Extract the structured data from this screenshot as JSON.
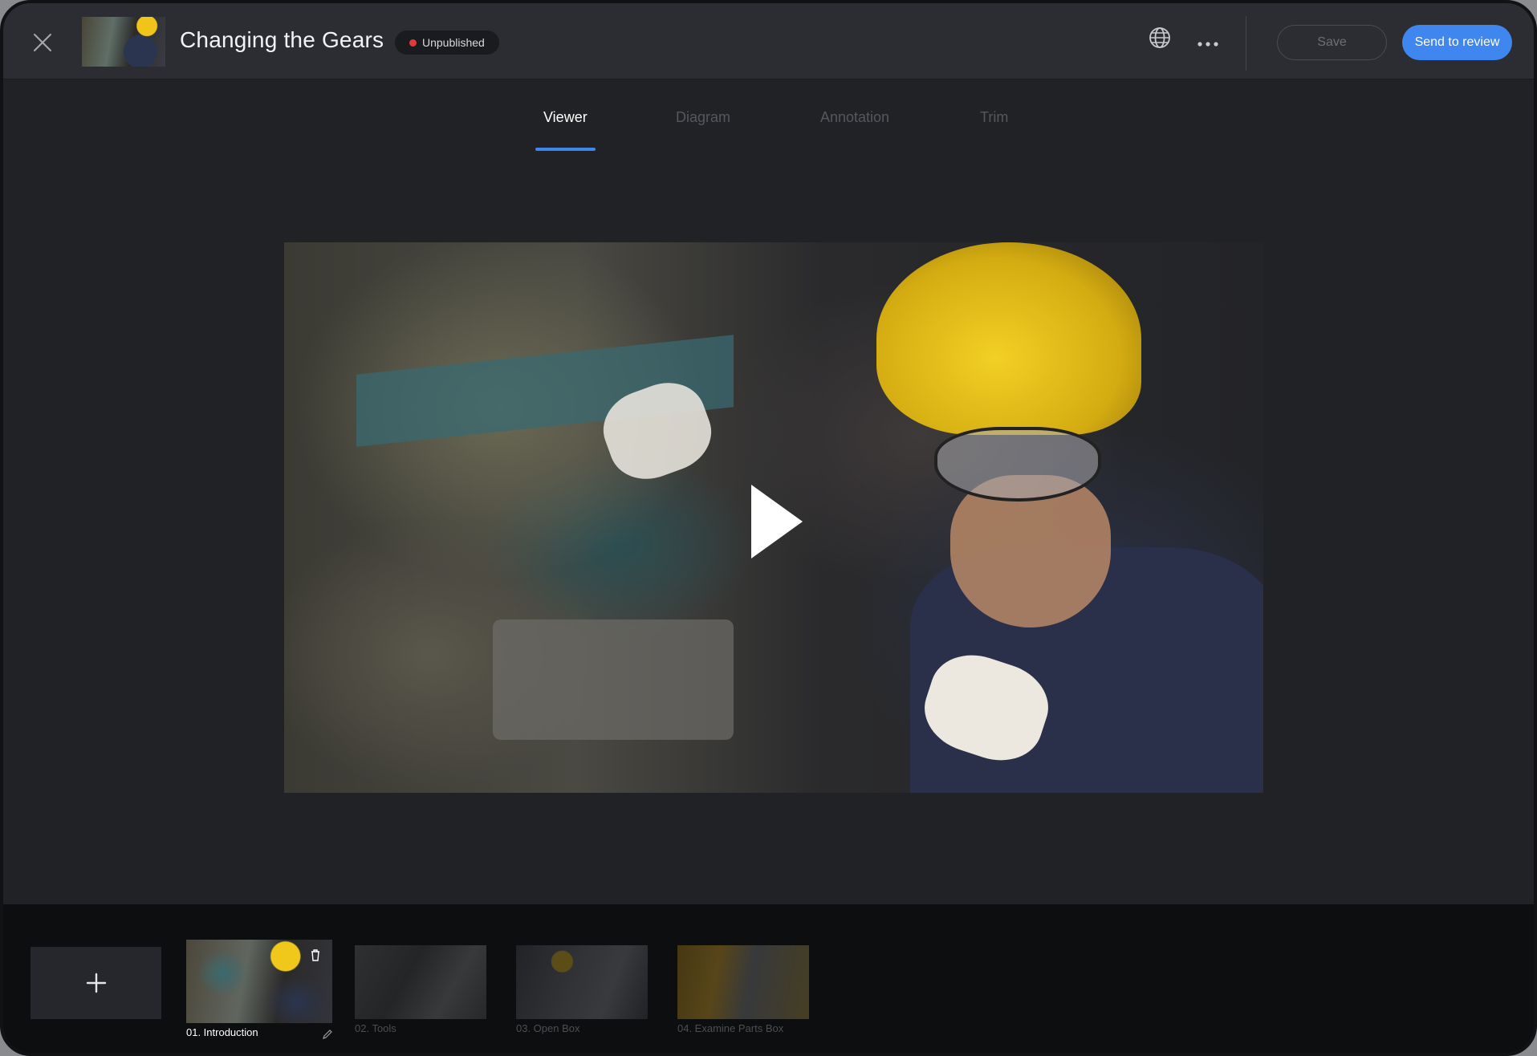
{
  "header": {
    "title": "Changing the Gears",
    "status": "Unpublished",
    "save_label": "Save",
    "review_label": "Send to review"
  },
  "tabs": [
    {
      "label": "Viewer",
      "active": true
    },
    {
      "label": "Diagram",
      "active": false
    },
    {
      "label": "Annotation",
      "active": false
    },
    {
      "label": "Trim",
      "active": false
    }
  ],
  "clips": [
    {
      "label": "01. Introduction",
      "selected": true
    },
    {
      "label": "02. Tools",
      "selected": false
    },
    {
      "label": "03. Open Box",
      "selected": false
    },
    {
      "label": "04. Examine Parts Box",
      "selected": false
    }
  ],
  "icons": {
    "close": "close-icon",
    "globe": "globe-icon",
    "more": "more-horizontal-icon",
    "play": "play-icon",
    "add": "plus-icon",
    "trash": "trash-icon",
    "pencil": "pencil-icon"
  },
  "colors": {
    "accent": "#3f86ee",
    "status_dot": "#e03a3a",
    "background": "#212226",
    "header": "#2c2d32"
  }
}
